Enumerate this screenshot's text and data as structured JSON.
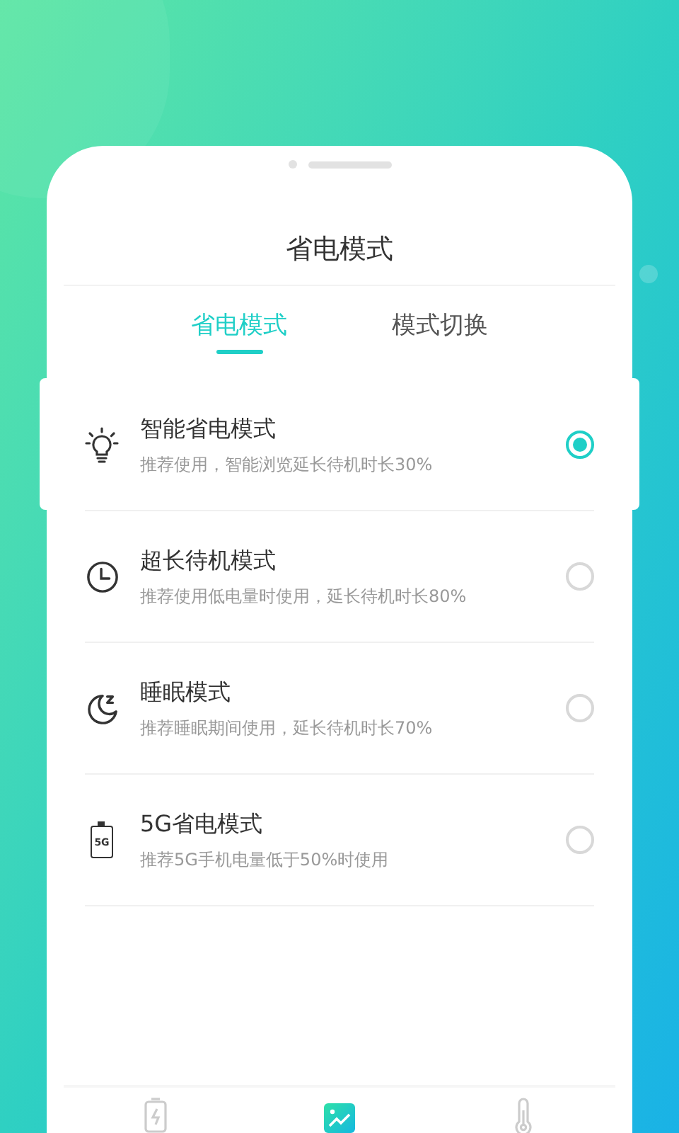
{
  "sheet": {
    "title": "省电模式"
  },
  "tabs": [
    {
      "label": "省电模式",
      "selected": true
    },
    {
      "label": "模式切换",
      "selected": false
    }
  ],
  "modes": [
    {
      "kind": "bulb",
      "name": "智能省电模式",
      "description": "推荐使用，智能浏览延长待机时长30%",
      "selected": true
    },
    {
      "kind": "clock",
      "name": "超长待机模式",
      "description": "推荐使用低电量时使用，延长待机时长80%",
      "selected": false
    },
    {
      "kind": "sleep",
      "name": "睡眠模式",
      "description": "推荐睡眠期间使用，延长待机时长70%",
      "selected": false
    },
    {
      "kind": "battery",
      "icon_text": "5G",
      "name": "5G省电模式",
      "description": "推荐5G手机电量低于50%时使用",
      "selected": false
    }
  ],
  "bottom_nav": [
    {
      "kind": "battery",
      "selected": false
    },
    {
      "kind": "chart",
      "selected": true
    },
    {
      "kind": "thermometer",
      "selected": false
    }
  ]
}
